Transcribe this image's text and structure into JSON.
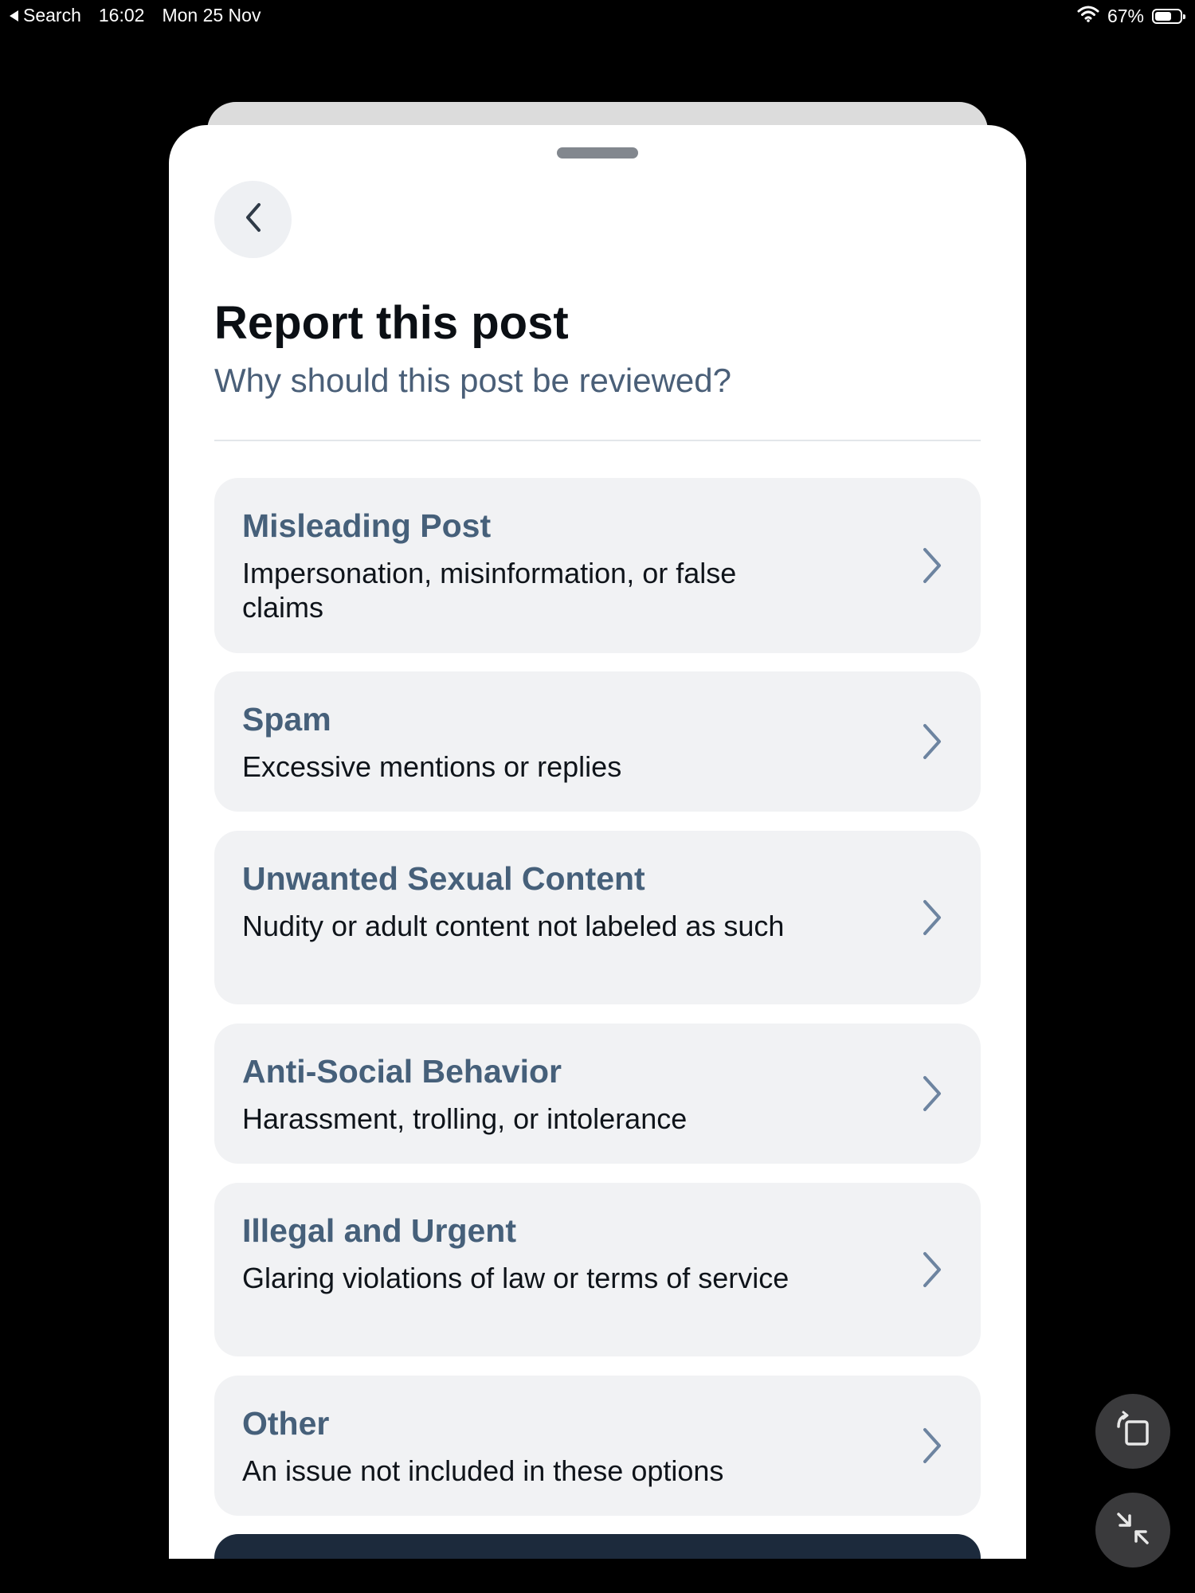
{
  "status_bar": {
    "back_app": "Search",
    "time": "16:02",
    "date": "Mon 25 Nov",
    "battery": "67%",
    "battery_level": 0.67
  },
  "sheet": {
    "title": "Report this post",
    "subtitle": "Why should this post be reviewed?",
    "options": [
      {
        "label": "Misleading Post",
        "description": "Impersonation, misinformation, or false claims"
      },
      {
        "label": "Spam",
        "description": "Excessive mentions or replies"
      },
      {
        "label": "Unwanted Sexual Content",
        "description": "Nudity or adult content not labeled as such"
      },
      {
        "label": "Anti-Social Behavior",
        "description": "Harassment, trolling, or intolerance"
      },
      {
        "label": "Illegal and Urgent",
        "description": "Glaring violations of law or terms of service"
      },
      {
        "label": "Other",
        "description": "An issue not included in these options"
      }
    ]
  },
  "icons": {
    "back": "chevron-left-icon",
    "option_arrow": "chevron-right-icon",
    "rotate": "rotate-screen-icon",
    "minimize": "collapse-arrows-icon",
    "wifi": "wifi-icon",
    "battery": "battery-icon"
  },
  "colors": {
    "background": "#000000",
    "sheet": "#ffffff",
    "option_bg": "#f1f2f4",
    "option_label": "#46607a",
    "subtitle": "#4a5f78",
    "submit_button": "#1c2a3c"
  }
}
